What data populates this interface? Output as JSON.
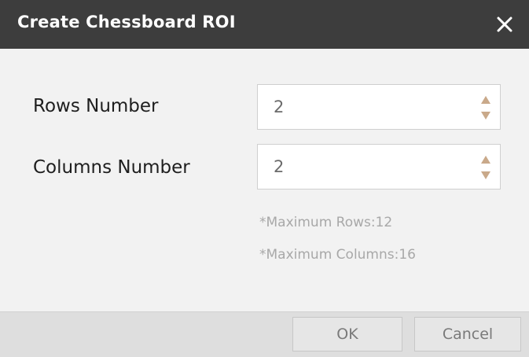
{
  "dialog": {
    "title": "Create Chessboard ROI",
    "close_icon": "close-icon"
  },
  "fields": {
    "rows": {
      "label": "Rows Number",
      "value": "2"
    },
    "columns": {
      "label": "Columns Number",
      "value": "2"
    }
  },
  "hints": {
    "max_rows": "*Maximum Rows:12",
    "max_columns": "*Maximum Columns:16"
  },
  "buttons": {
    "ok_label": "OK",
    "cancel_label": "Cancel"
  },
  "colors": {
    "titlebar": "#3d3d3d",
    "body": "#f2f2f2",
    "footer": "#dedede",
    "spinner_arrow": "#c9a98a"
  }
}
